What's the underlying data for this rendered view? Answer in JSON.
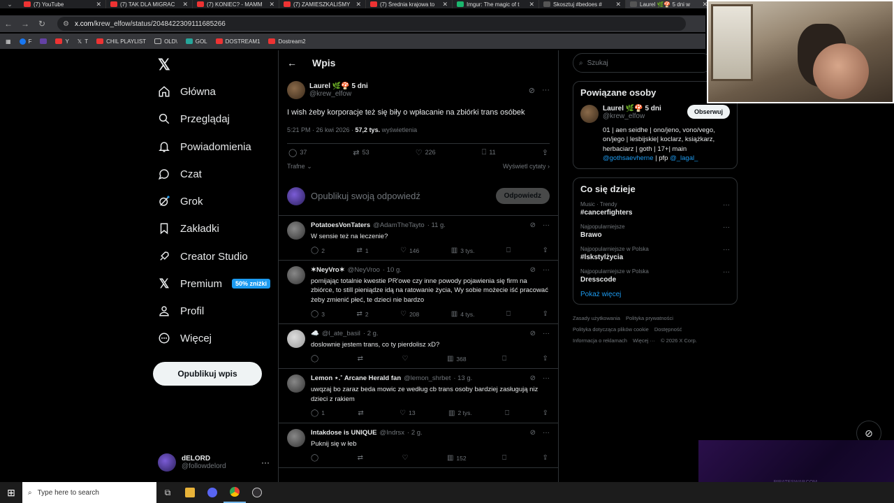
{
  "browser": {
    "tabs": [
      {
        "title": "(7) YouTube",
        "color": "red"
      },
      {
        "title": "(7) TAK DLA MIGRAC",
        "color": "red"
      },
      {
        "title": "(7) KONIEC? - MAMM",
        "color": "red"
      },
      {
        "title": "(7) ZAMIESZKALIŚMY",
        "color": "red"
      },
      {
        "title": "(7) Średnia krajowa to",
        "color": "red"
      },
      {
        "title": "Imgur: The magic of t",
        "color": "green"
      },
      {
        "title": "Skosztuj #bedoes #",
        "color": "dark"
      },
      {
        "title": "Laurel 🌿🍄 5 dni w",
        "color": "dark",
        "active": true
      }
    ],
    "url_host": "x.com",
    "url_path": "/krew_elfow/status/2048422309111685266",
    "bookmarks": [
      "F",
      "Y",
      "T",
      "CHIL PLAYLIST",
      "OLD\\",
      "GOL",
      "DOSTREAM1",
      "Dostream2"
    ]
  },
  "nav": {
    "items": [
      {
        "label": "Główna",
        "icon": "home-icon"
      },
      {
        "label": "Przeglądaj",
        "icon": "search-icon"
      },
      {
        "label": "Powiadomienia",
        "icon": "bell-icon"
      },
      {
        "label": "Czat",
        "icon": "chat-icon"
      },
      {
        "label": "Grok",
        "icon": "grok-icon"
      },
      {
        "label": "Zakładki",
        "icon": "bookmark-icon"
      },
      {
        "label": "Creator Studio",
        "icon": "rocket-icon"
      },
      {
        "label": "Premium",
        "icon": "x-icon"
      },
      {
        "label": "Profil",
        "icon": "person-icon"
      },
      {
        "label": "Więcej",
        "icon": "more-icon"
      }
    ],
    "premium_badge": "50% zniżki",
    "post_button": "Opublikuj wpis",
    "user": {
      "name": "dELORD",
      "handle": "@followdelord"
    }
  },
  "main": {
    "title": "Wpis",
    "post": {
      "author": "Laurel 🌿🍄 5 dni",
      "handle": "@krew_elfow",
      "text": "I wish żeby korporacje też się biły o wpłacanie na zbiórki trans osóbek",
      "time": "5:21 PM · 26 kwi 2026 · ",
      "views": "57,2 tys.",
      "views_label": " wyświetlenia",
      "replies": "37",
      "reposts": "53",
      "likes": "226",
      "bookmarks": "11",
      "sort": "Trafne",
      "show_quotes": "Wyświetl cytaty"
    },
    "reply_placeholder": "Opublikuj swoją odpowiedź",
    "reply_button": "Odpowiedz",
    "replies": [
      {
        "name": "PotatoesVonTaters",
        "handle": "@AdamTheTayto",
        "time": "· 11 g.",
        "text": "W sensie też na leczenie?",
        "replies": "2",
        "reposts": "1",
        "likes": "146",
        "views": "3 tys."
      },
      {
        "name": "✶NeyVro✶",
        "handle": "@NeyVroo",
        "time": "· 10 g.",
        "text": "pomijając totalnie kwestie PR'owe czy inne powody pojawienia się firm na zbiórce, to still pieniądze idą na ratowanie życia, Wy sobie możecie iść pracować żeby zmienić płeć, te dzieci nie bardzo",
        "replies": "3",
        "reposts": "2",
        "likes": "208",
        "views": "4 tys."
      },
      {
        "name": "☁️",
        "handle": "@l_ate_basil",
        "time": "· 2 g.",
        "text": "doslownie jestem trans, co ty pierdolisz xD?",
        "replies": "",
        "reposts": "",
        "likes": "",
        "views": "368"
      },
      {
        "name": "Lemon ⋆.˚ Arcane Herald fan",
        "handle": "@lemon_shrbet",
        "time": "· 13 g.",
        "text": "uwqzaj bo zaraz beda mowic ze według cb trans osoby bardziej zasługują niz dzieci z rakiem",
        "replies": "1",
        "reposts": "",
        "likes": "13",
        "views": "2 tys."
      },
      {
        "name": "Intakdose is UNIQUE",
        "handle": "@Indrsx",
        "time": "· 2 g.",
        "text": "Puknij się w łeb",
        "replies": "",
        "reposts": "",
        "likes": "",
        "views": "152"
      }
    ]
  },
  "right": {
    "search_placeholder": "Szukaj",
    "related": {
      "title": "Powiązane osoby",
      "name": "Laurel 🌿🍄 5 dni",
      "handle": "@krew_elfow",
      "follow": "Obserwuj",
      "bio": "01 | aen seidhe | ono/jeno, vono/vego, on/jego | lesbijskie| koclarz, książkarz, herbaciarz | goth | 17+| main ",
      "bio_link1": "@gothsaevherne",
      "bio_mid": " | pfp ",
      "bio_link2": "@_lagal_"
    },
    "trends": {
      "title": "Co się dzieje",
      "items": [
        {
          "context": "Music · Trendy",
          "name": "#cancerfighters"
        },
        {
          "context": "Najpopularniejsze",
          "name": "Brawo"
        },
        {
          "context": "Najpopularniejsze w Polska",
          "name": "#lskstylżycia"
        },
        {
          "context": "Najpopularniejsze w Polska",
          "name": "Dresscode"
        }
      ],
      "show_more": "Pokaż więcej"
    },
    "footer": [
      "Zasady użytkowania",
      "Polityka prywatności",
      "Polityka dotycząca plików cookie",
      "Dostępność",
      "Informacja o reklamach",
      "Więcej ···",
      "© 2026 X Corp."
    ]
  },
  "overlay": {
    "watermark": "PIRATESWAP.COM"
  },
  "taskbar": {
    "search_placeholder": "Type here to search"
  }
}
